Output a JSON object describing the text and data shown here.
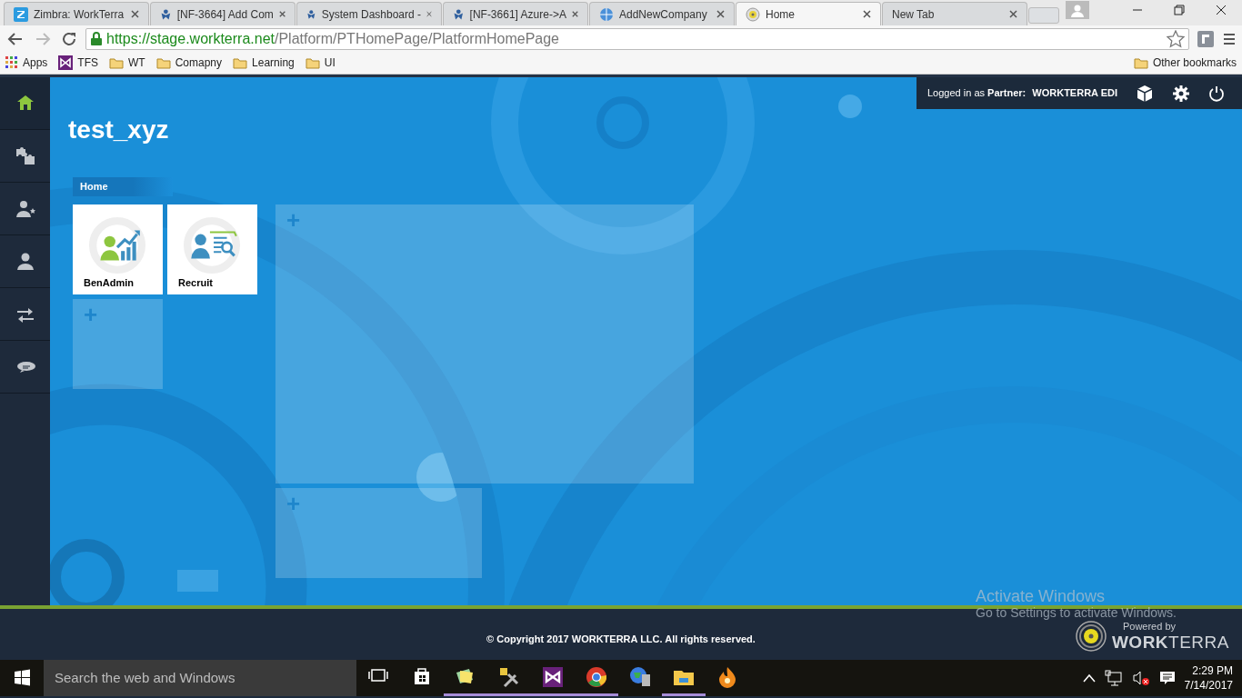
{
  "browser": {
    "tabs": [
      {
        "title": "Zimbra: WorkTerra",
        "kind": "zimbra",
        "selected": false
      },
      {
        "title": "[NF-3664] Add Com",
        "kind": "jira",
        "selected": false
      },
      {
        "title": "System Dashboard -",
        "kind": "jira",
        "selected": false
      },
      {
        "title": "[NF-3661] Azure->A",
        "kind": "jira",
        "selected": false
      },
      {
        "title": "AddNewCompany",
        "kind": "page",
        "selected": false
      },
      {
        "title": "Home",
        "kind": "workterra",
        "selected": true
      },
      {
        "title": "New Tab",
        "kind": "none",
        "selected": false
      }
    ],
    "url": {
      "scheme_host": "https://stage.workterra.net",
      "path": "/Platform/PTHomePage/PlatformHomePage"
    },
    "bookmarks": [
      {
        "label": "Apps",
        "kind": "apps"
      },
      {
        "label": "TFS",
        "kind": "vs"
      },
      {
        "label": "WT",
        "kind": "folder"
      },
      {
        "label": "Comapny",
        "kind": "folder"
      },
      {
        "label": "Learning",
        "kind": "folder"
      },
      {
        "label": "UI",
        "kind": "folder"
      }
    ],
    "other_bookmarks": "Other bookmarks"
  },
  "app": {
    "sidebar": [
      {
        "kind": "home",
        "selected": true
      },
      {
        "kind": "puzzle",
        "selected": false
      },
      {
        "kind": "user-star",
        "selected": false
      },
      {
        "kind": "user",
        "selected": false
      },
      {
        "kind": "arrows",
        "selected": false
      },
      {
        "kind": "chat",
        "selected": false
      }
    ],
    "header": {
      "prefix": "Logged in as",
      "role": "Partner:",
      "partner": "WORKTERRA EDI"
    },
    "title": "test_xyz",
    "breadcrumb": "Home",
    "tiles": [
      {
        "label": "BenAdmin",
        "kind": "benadmin"
      },
      {
        "label": "Recruit",
        "kind": "recruit"
      }
    ],
    "add_slots": [
      {
        "mark": "+",
        "kind": "small"
      },
      {
        "mark": "+",
        "kind": "large"
      },
      {
        "mark": "+",
        "kind": "wide"
      }
    ],
    "footer": {
      "copyright": "© Copyright 2017 WORKTERRA LLC. All rights reserved.",
      "powered_by": "Powered by",
      "brand": "**WORK**TERRA"
    }
  },
  "activation": {
    "title": "Activate Windows",
    "message": "Go to Settings to activate Windows."
  },
  "taskbar": {
    "search_placeholder": "Search the web and Windows",
    "apps": [
      {
        "kind": "taskview",
        "running": false
      },
      {
        "kind": "store",
        "running": false
      },
      {
        "kind": "notes",
        "running": true
      },
      {
        "kind": "tools",
        "running": true
      },
      {
        "kind": "vs",
        "running": true
      },
      {
        "kind": "chrome",
        "running": true
      },
      {
        "kind": "globe",
        "running": false
      },
      {
        "kind": "explorer",
        "running": true
      },
      {
        "kind": "flame",
        "running": false
      }
    ],
    "time": "2:29 PM",
    "date": "7/14/2017"
  }
}
